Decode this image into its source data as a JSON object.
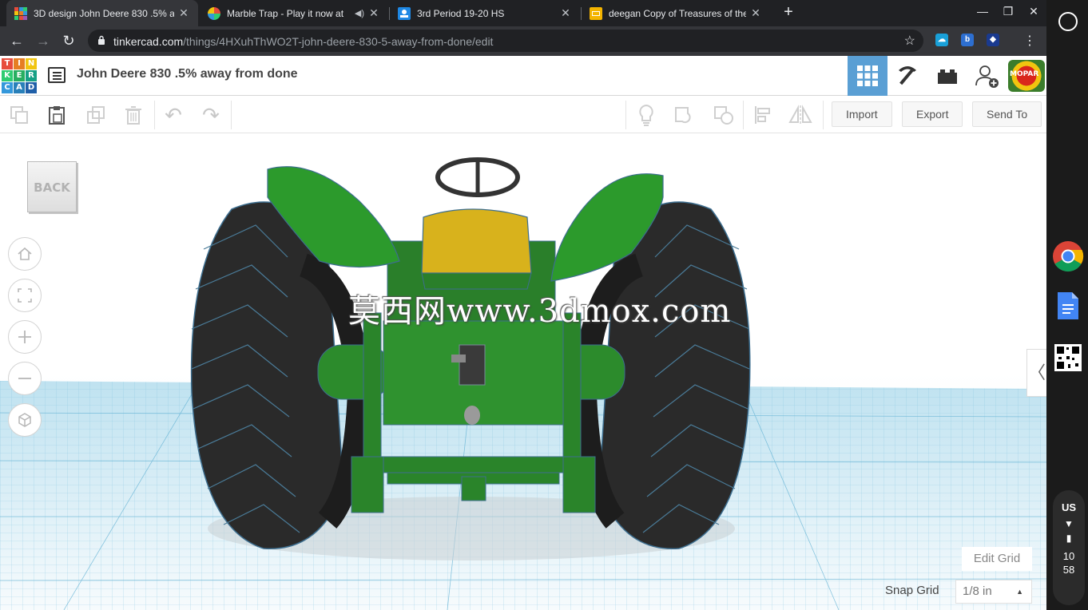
{
  "browser": {
    "tabs": [
      {
        "title": "3D design John Deere 830 .5% a",
        "active": true
      },
      {
        "title": "Marble Trap - Play it now at",
        "active": false,
        "audio": true
      },
      {
        "title": "3rd Period 19-20 HS",
        "active": false
      },
      {
        "title": "deegan Copy of Treasures of the",
        "active": false
      }
    ],
    "url_host": "tinkercad.com",
    "url_path": "/things/4HXuhThWO2T-john-deere-830-5-away-from-done/edit"
  },
  "header": {
    "logo_letters": [
      "TIN",
      "KER",
      "CAD"
    ],
    "design_title": "John Deere 830 .5% away from done",
    "avatar_text": "MOPAR"
  },
  "toolbar": {
    "import_label": "Import",
    "export_label": "Export",
    "send_to_label": "Send To"
  },
  "workplane": {
    "back_label": "BACK",
    "watermark": "莫西网www.3dmox.com",
    "edit_grid_label": "Edit Grid",
    "snap_grid_label": "Snap Grid",
    "snap_grid_value": "1/8 in"
  },
  "shelf": {
    "input_method": "US",
    "time_hour": "10",
    "time_minute": "58"
  },
  "colors": {
    "tractor_green": "#2e8b2e",
    "tractor_yellow": "#d8b21c",
    "tire_black": "#2a2a2a",
    "grid_blue": "#86cbe6",
    "tinkercad_active": "#5a9fd4"
  }
}
